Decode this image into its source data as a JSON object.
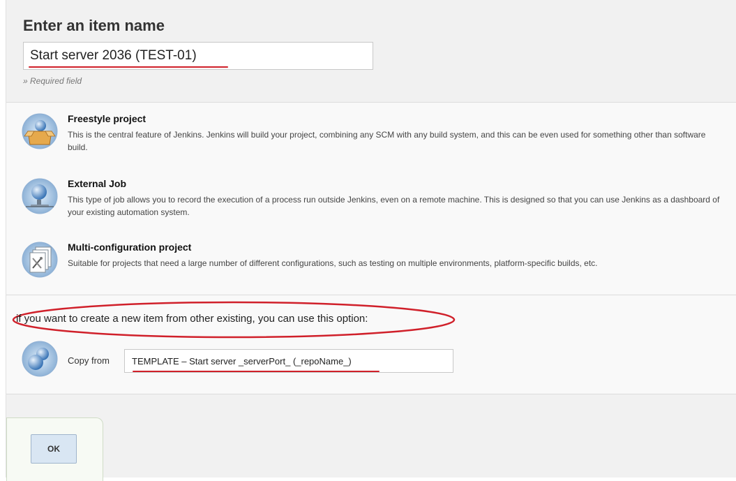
{
  "form": {
    "title": "Enter an item name",
    "name_value": "Start server 2036 (TEST-01)",
    "required_hint": "» Required field"
  },
  "items": [
    {
      "title": "Freestyle project",
      "description": "This is the central feature of Jenkins. Jenkins will build your project, combining any SCM with any build system, and this can be even used for something other than software build.",
      "icon": "package-icon"
    },
    {
      "title": "External Job",
      "description": "This type of job allows you to record the execution of a process run outside Jenkins, even on a remote machine. This is designed so that you can use Jenkins as a dashboard of your existing automation system.",
      "icon": "monitor-globe-icon"
    },
    {
      "title": "Multi-configuration project",
      "description": "Suitable for projects that need a large number of different configurations, such as testing on multiple environments, platform-specific builds, etc.",
      "icon": "stacked-documents-icon"
    }
  ],
  "copy": {
    "hint": "if you want to create a new item from other existing, you can use this option:",
    "label": "Copy from",
    "value": "TEMPLATE – Start server _serverPort_ (_repoName_)",
    "icon": "copy-spheres-icon"
  },
  "buttons": {
    "ok_label": "OK"
  },
  "colors": {
    "annotation_red": "#d0202a",
    "ok_button_bg": "#d9e6f3"
  }
}
